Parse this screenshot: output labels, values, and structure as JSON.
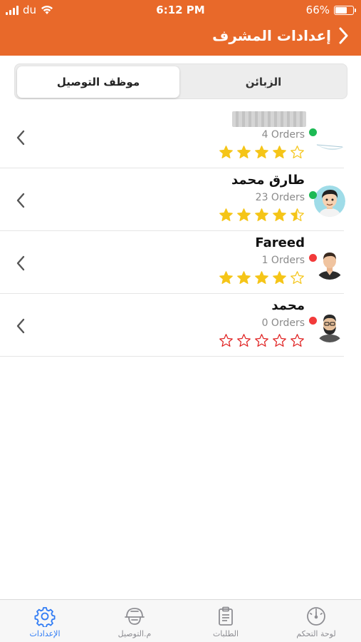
{
  "status_bar": {
    "carrier": "du",
    "time": "6:12 PM",
    "battery": "66%",
    "battery_level": 0.66
  },
  "header": {
    "title": "إعدادات المشرف",
    "back_icon": "chevron-right-icon"
  },
  "segmented": {
    "selected": "delivery_staff",
    "options": {
      "delivery_staff": "موظف التوصيل",
      "customers": "الزبائن"
    }
  },
  "staff": [
    {
      "name": "",
      "name_hidden": true,
      "orders": "4 Orders",
      "status": "online",
      "status_color": "#1DB954",
      "rating": 4,
      "avatar": "placeholder-avatar"
    },
    {
      "name": "طارق محمد",
      "orders": "23 Orders",
      "status": "online",
      "status_color": "#1DB954",
      "rating": 4.5,
      "avatar": "cartoon-man-avatar"
    },
    {
      "name": "Fareed",
      "orders": "1 Orders",
      "status": "offline",
      "status_color": "#F23A3A",
      "rating": 4,
      "avatar": "man-avatar"
    },
    {
      "name": "محمد",
      "orders": "0 Orders",
      "status": "offline",
      "status_color": "#F23A3A",
      "rating": 0,
      "avatar": "bearded-man-avatar"
    }
  ],
  "star_colors": {
    "filled": "#F5C518",
    "empty_gold": "#F5C518",
    "empty_red": "#E02020"
  },
  "tabbar": {
    "active": "settings",
    "accent": "#2F7BF5",
    "tabs": {
      "settings": {
        "label": "الإعدادات",
        "icon": "gear-icon"
      },
      "delivery": {
        "label": "م.التوصيل",
        "icon": "delivery-helmet-icon"
      },
      "orders": {
        "label": "الطلبات",
        "icon": "clipboard-icon"
      },
      "dashboard": {
        "label": "لوحة التحكم",
        "icon": "speedometer-icon"
      }
    }
  }
}
